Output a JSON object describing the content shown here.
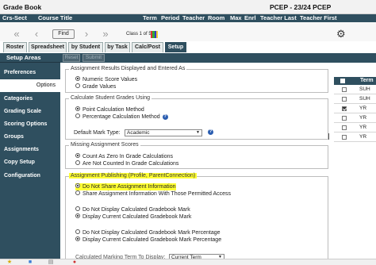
{
  "app_title": "Grade Book",
  "period_title": "PCEP - 23/24 PCEP",
  "column_headers": [
    "Crs-Sect",
    "Course Title",
    "Term",
    "Period",
    "Teacher",
    "Room",
    "Max",
    "Enrl",
    "Teacher Last",
    "Teacher First"
  ],
  "nav": {
    "find_label": "Find",
    "class_indicator": "Class 1 of 5"
  },
  "tabs": [
    "Roster",
    "Spreadsheet",
    "by Student",
    "by Task",
    "Calc/Post",
    "Setup"
  ],
  "sidebar": {
    "header": "Setup Areas",
    "items": [
      "Preferences",
      "Options",
      "Categories",
      "Grading Scale",
      "Scoring Options",
      "Groups",
      "Assignments",
      "Copy Setup",
      "Configuration"
    ]
  },
  "toolbar": {
    "reset_label": "Reset",
    "submit_label": "Submit"
  },
  "results_group": {
    "legend": "Assignment Results Displayed and Entered As",
    "options": [
      "Numeric Score Values",
      "Grade Values"
    ]
  },
  "calc_group": {
    "legend": "Calculate Student Grades Using",
    "options": [
      "Point Calculation Method",
      "Percentage Calculation Method"
    ],
    "default_mark_label": "Default Mark Type:",
    "default_mark_value": "Academic"
  },
  "missing_group": {
    "legend": "Missing Assignment Scores",
    "options": [
      "Count As Zero In Grade Calculations",
      "Are Not Counted In Grade Calculations"
    ]
  },
  "publish_group": {
    "legend": "Assignment Publishing (Profile, ParentConnection)",
    "options": [
      "Do Not Share Assignment Information",
      "Share Assignment Information With Those Permitted Access",
      "Do Not Display Calculated Gradebook Mark",
      "Display Current Calculated Gradebook Mark",
      "Do Not Display Calculated Gradebook Mark Percentage",
      "Display Current Calculated Gradebook Mark Percentage"
    ],
    "partial_label": "Calculated Marking Term To Display:",
    "partial_select": "Current Term"
  },
  "term_table": {
    "header": "Term",
    "rows": [
      {
        "term": "SUH",
        "checked": false
      },
      {
        "term": "SUH",
        "checked": false
      },
      {
        "term": "YR",
        "checked": true
      },
      {
        "term": "YR",
        "checked": false
      },
      {
        "term": "YR",
        "checked": false
      },
      {
        "term": "YR",
        "checked": false
      }
    ]
  },
  "colors": {
    "header_bg": "#2f4f5f",
    "highlight": "#ffff33",
    "help_icon": "#2a5db0"
  }
}
